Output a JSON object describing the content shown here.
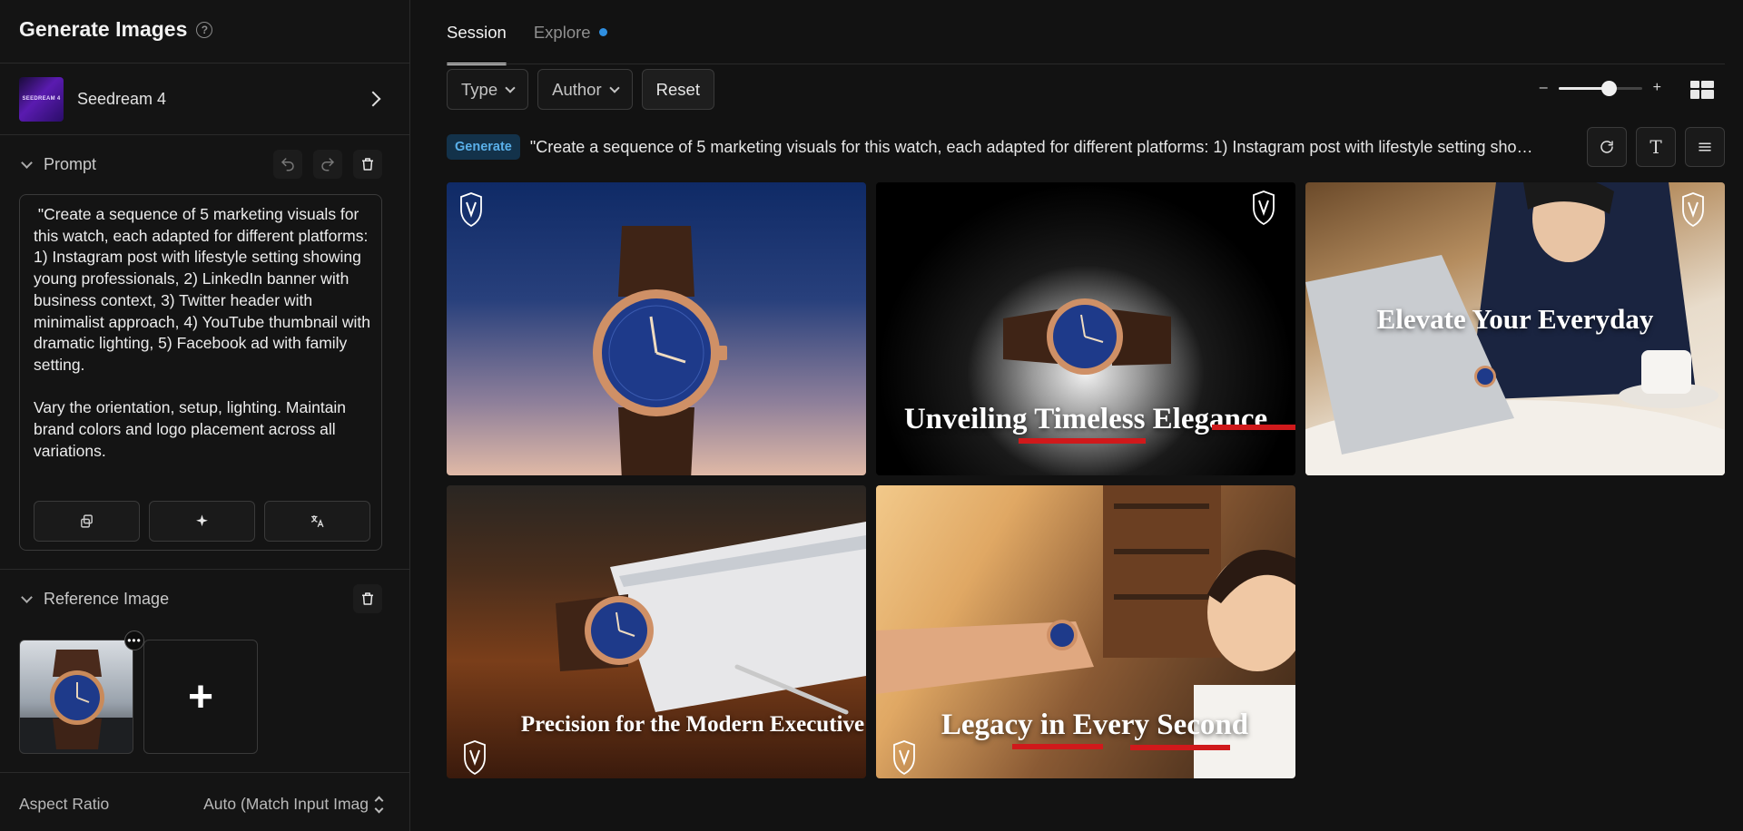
{
  "sidebar": {
    "title": "Generate Images",
    "model": {
      "name": "Seedream 4",
      "thumb_text": "SEEDREAM 4"
    },
    "prompt": {
      "label": "Prompt",
      "text": " \"Create a sequence of 5 marketing visuals for this watch, each adapted for different platforms: 1) Instagram post with lifestyle setting showing young professionals, 2) LinkedIn banner with business context, 3) Twitter header with minimalist approach, 4) YouTube thumbnail with dramatic lighting, 5) Facebook ad with family setting.\n\nVary the orientation, setup, lighting. Maintain brand colors and logo placement across all variations."
    },
    "reference": {
      "label": "Reference Image",
      "more": "•••",
      "add": "+"
    },
    "aspect": {
      "label": "Aspect Ratio",
      "value": "Auto (Match Input Imag"
    }
  },
  "main": {
    "tabs": [
      {
        "label": "Session"
      },
      {
        "label": "Explore"
      }
    ],
    "filters": {
      "type": "Type",
      "author": "Author",
      "reset": "Reset"
    },
    "zoom": {
      "minus": "–",
      "plus": "+",
      "level": 0.6
    },
    "generation": {
      "badge": "Generate",
      "prompt": "\"Create a sequence of 5 marketing visuals for this watch, each adapted for different platforms: 1) Instagram post with lifestyle setting showing young professionals, 2) LinkedIn banner with business context, 3) Twitter header with minimalist approach, 4) YouTube thumbnail with dramatic lighting, 5) Facebook ad with family setting.",
      "text_button": "T"
    },
    "images": [
      {
        "caption": ""
      },
      {
        "caption": "Unveiling Timeless Elegance"
      },
      {
        "caption": "Elevate Your Everyday"
      },
      {
        "caption": "Precision for the Modern Executive"
      },
      {
        "caption": "Legacy in Every Second"
      }
    ]
  },
  "colors": {
    "accent": "#2f8fe0",
    "badge_bg": "#13324a",
    "badge_text": "#5ab0ea",
    "brand_red": "#d0191b",
    "dial_blue": "#1e3a8a",
    "gold": "#c98a5a"
  }
}
